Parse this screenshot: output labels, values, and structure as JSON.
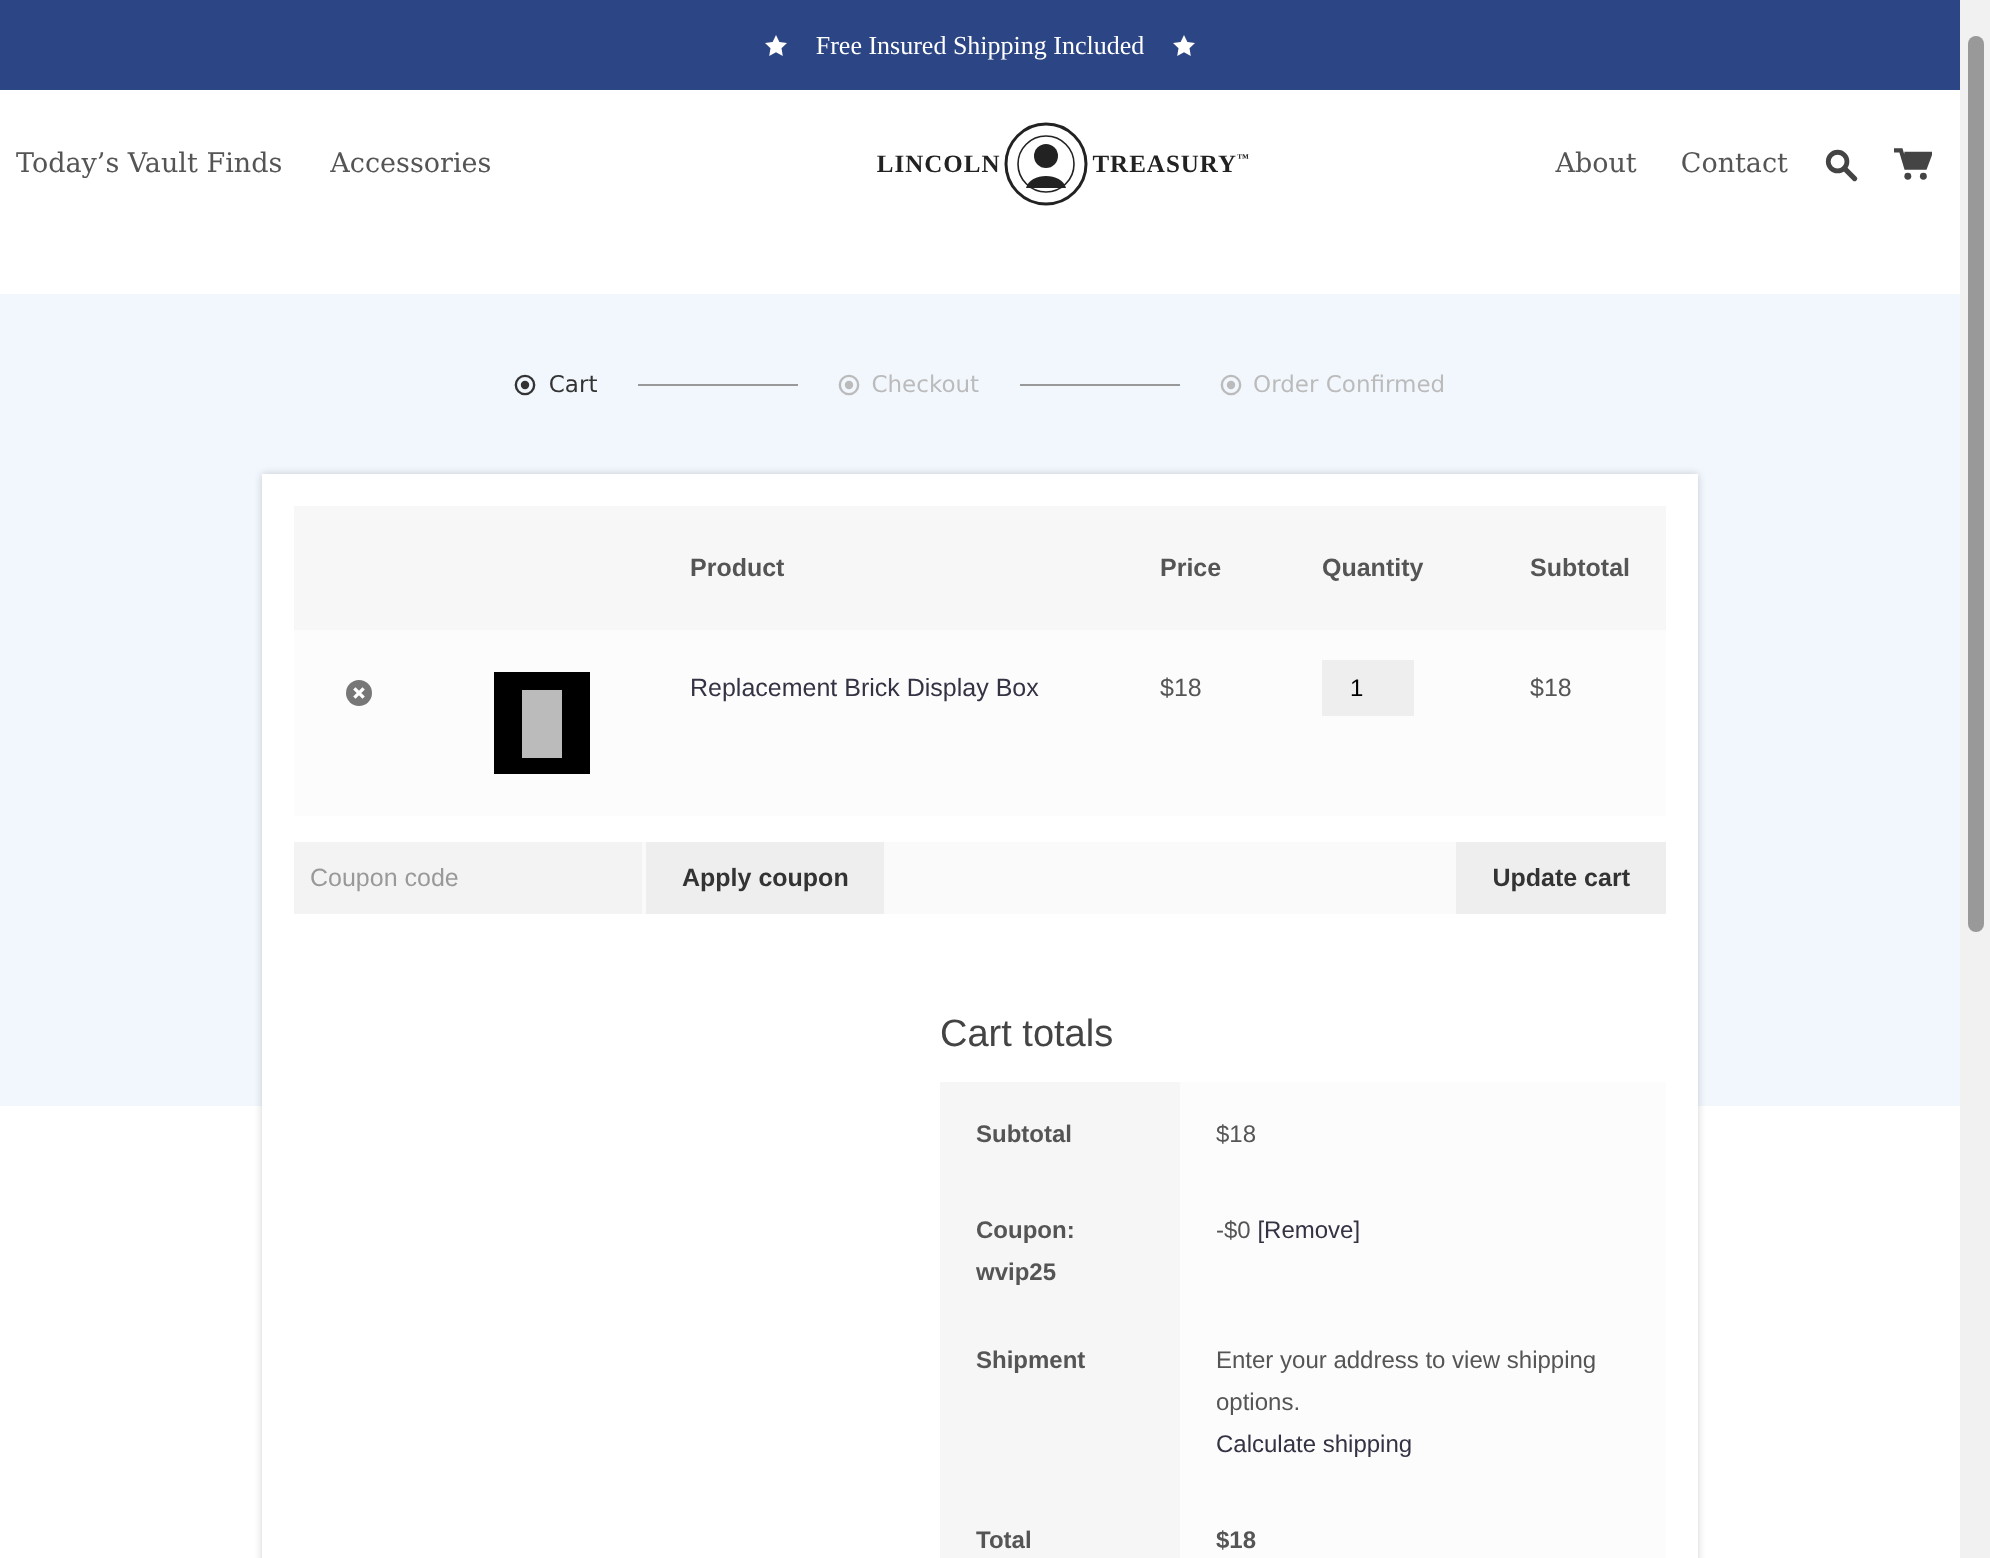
{
  "banner": {
    "text": "Free Insured Shipping Included"
  },
  "nav": {
    "left": [
      "Today’s Vault Finds",
      "Accessories"
    ],
    "logo": {
      "left": "LINCOLN",
      "right": "TREASURY",
      "mark": "™"
    },
    "right": [
      "About",
      "Contact"
    ]
  },
  "steps": [
    {
      "label": "Cart",
      "selected": true
    },
    {
      "label": "Checkout",
      "selected": false
    },
    {
      "label": "Order Confirmed",
      "selected": false
    }
  ],
  "cart_table": {
    "columns": [
      "Product",
      "Price",
      "Quantity",
      "Subtotal"
    ],
    "rows": [
      {
        "product": "Replacement Brick Display Box",
        "price": "$18",
        "quantity": "1",
        "subtotal": "$18"
      }
    ]
  },
  "coupon": {
    "placeholder": "Coupon code",
    "apply": "Apply coupon",
    "update": "Update cart"
  },
  "totals": {
    "title": "Cart totals",
    "rows": [
      {
        "kind": "plain",
        "label": "Subtotal",
        "value": "$18"
      },
      {
        "kind": "coupon",
        "label": "Coupon: wvip25",
        "value": "-$0",
        "link": "[Remove]"
      },
      {
        "kind": "shipping",
        "label": "Shipment",
        "value": "Enter your address to view shipping options.",
        "link": "Calculate shipping"
      },
      {
        "kind": "total",
        "label": "Total",
        "value": "$18"
      }
    ]
  }
}
